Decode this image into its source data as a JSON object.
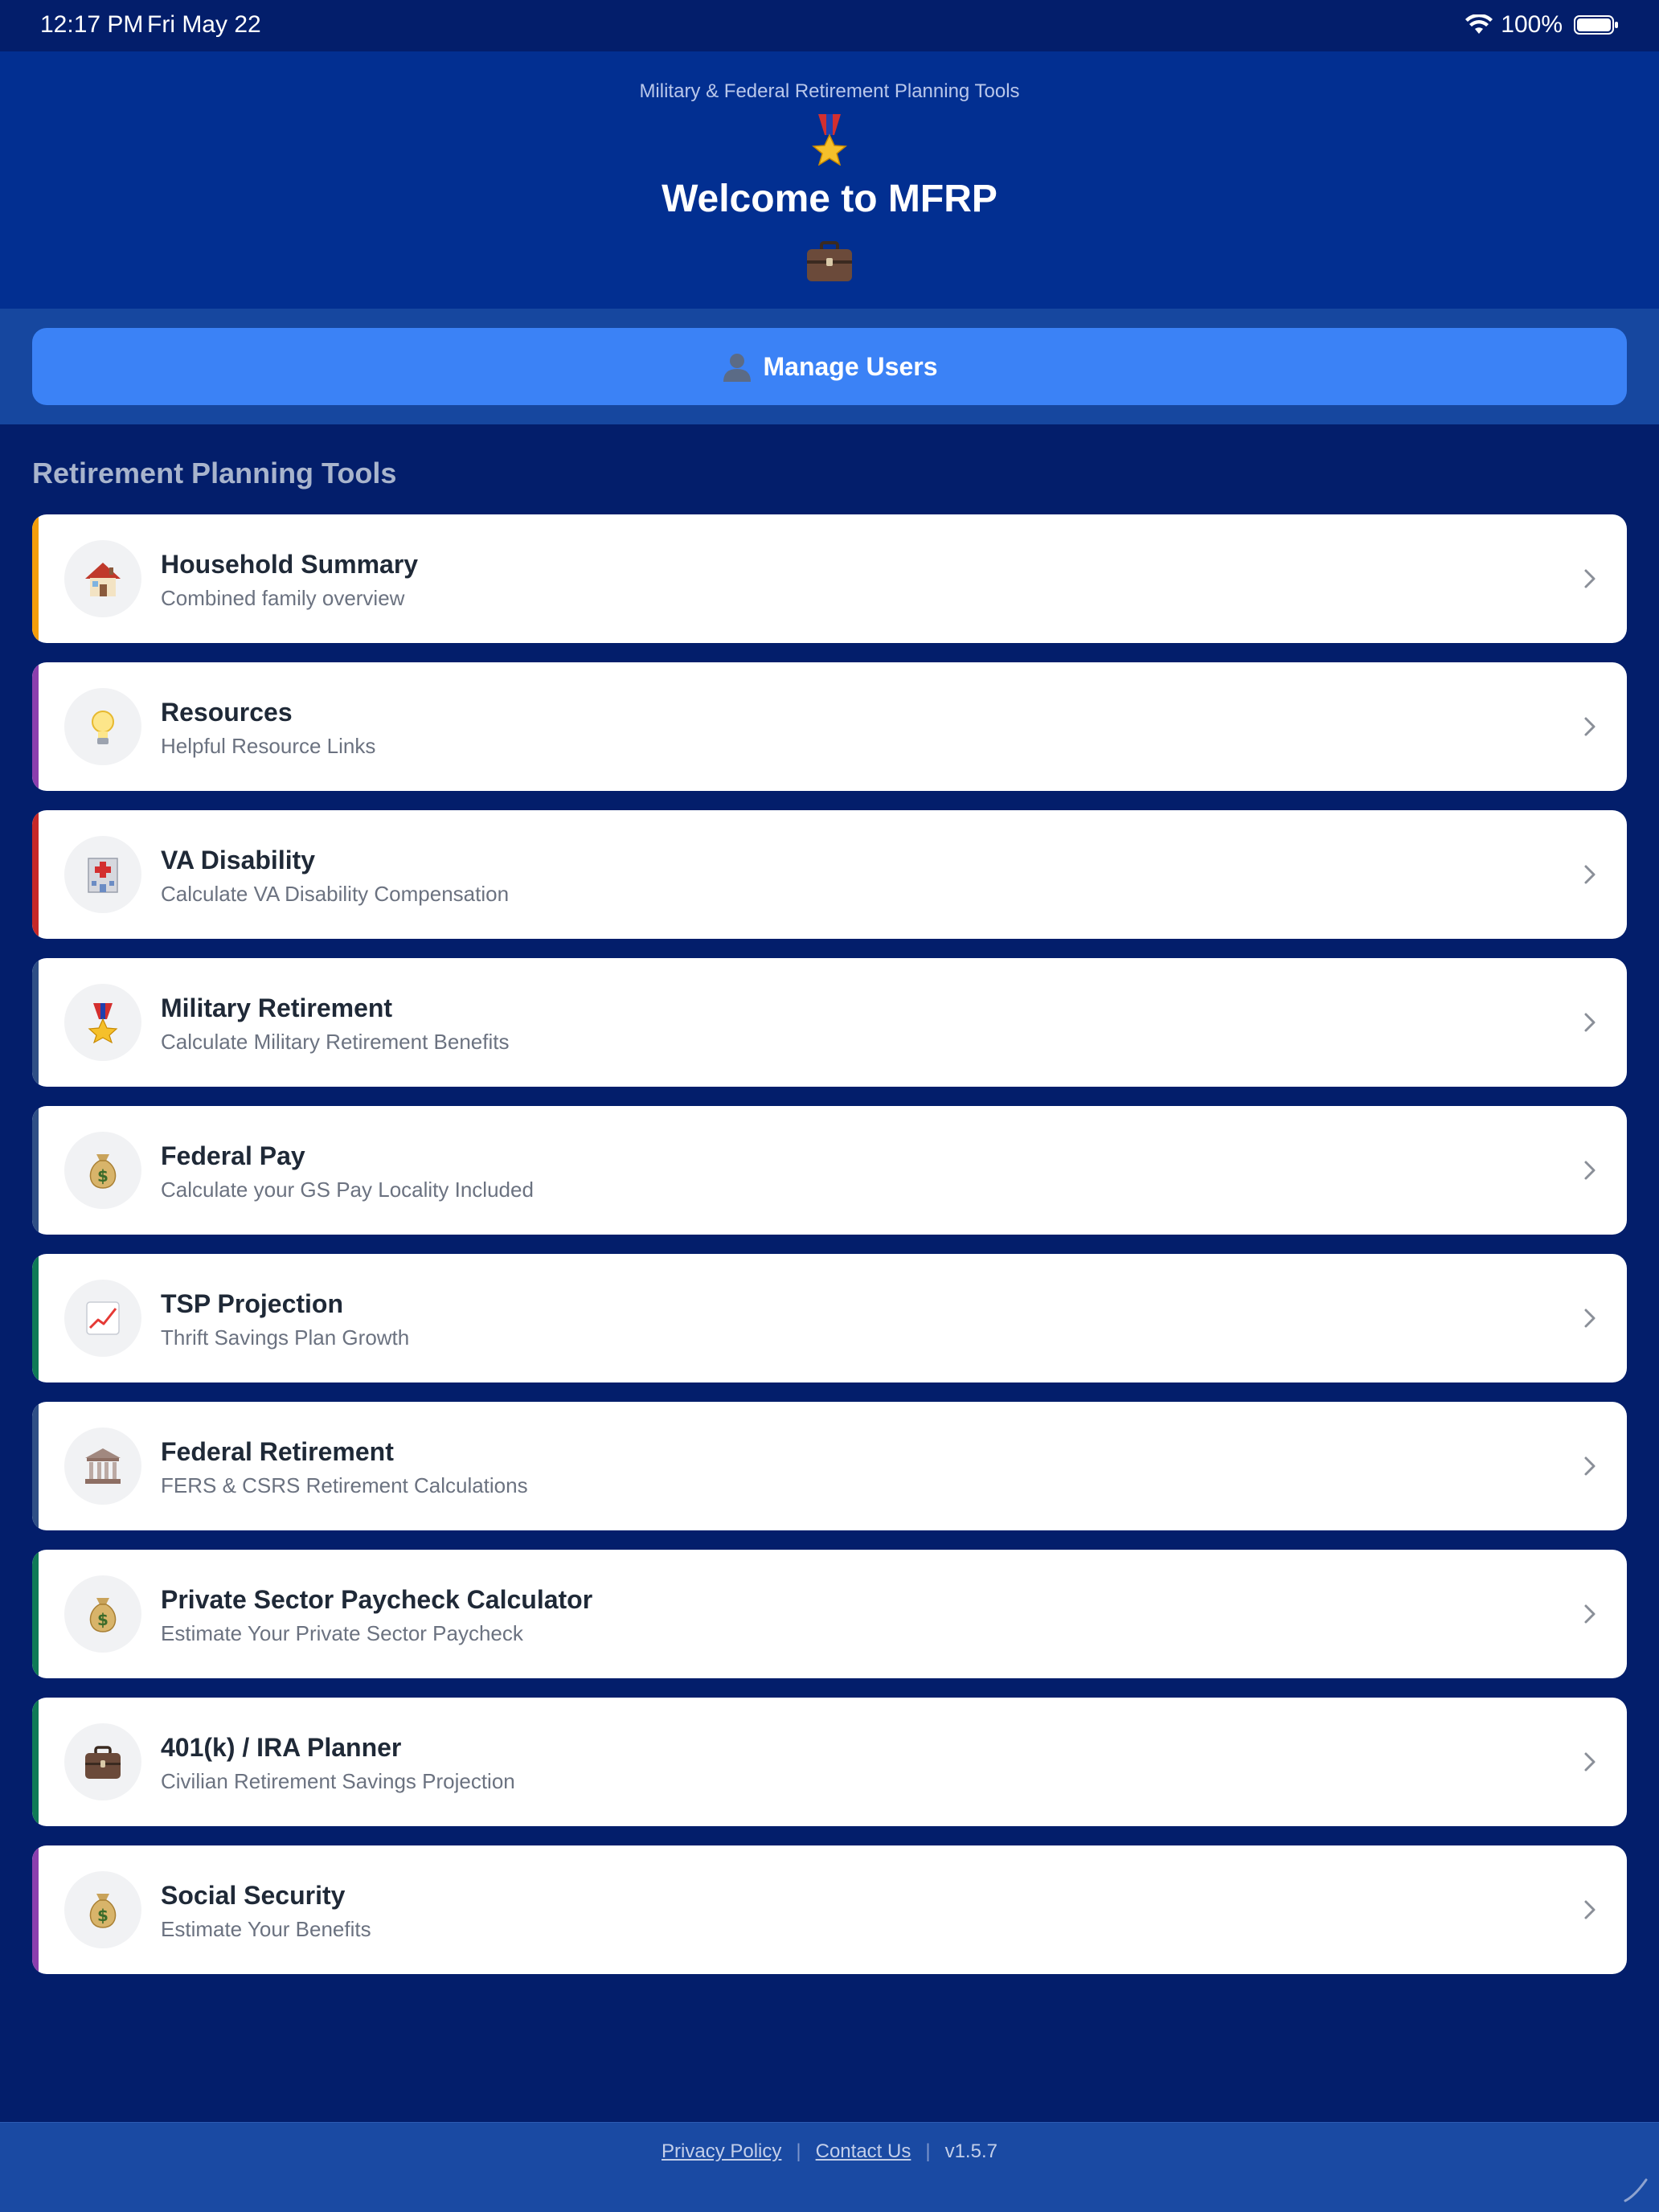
{
  "status": {
    "time": "12:17 PM",
    "date": "Fri May 22",
    "battery": "100%"
  },
  "hero": {
    "subtitle": "Military & Federal Retirement Planning Tools",
    "title": "Welcome to MFRP"
  },
  "manage_users": {
    "label": "Manage Users"
  },
  "section": {
    "title": "Retirement Planning Tools"
  },
  "tools": [
    {
      "title": "Household Summary",
      "subtitle": "Combined family overview",
      "icon": "house-icon",
      "accent": "#f59e0b"
    },
    {
      "title": "Resources",
      "subtitle": "Helpful Resource Links",
      "icon": "lightbulb-icon",
      "accent": "#8b3fae"
    },
    {
      "title": "VA Disability",
      "subtitle": "Calculate VA Disability Compensation",
      "icon": "hospital-icon",
      "accent": "#c62828"
    },
    {
      "title": "Military Retirement",
      "subtitle": "Calculate Military Retirement Benefits",
      "icon": "medal-icon",
      "accent": "#2f4f86"
    },
    {
      "title": "Federal Pay",
      "subtitle": "Calculate your GS Pay Locality Included",
      "icon": "money-bag-icon",
      "accent": "#2f4f86"
    },
    {
      "title": "TSP Projection",
      "subtitle": "Thrift Savings Plan Growth",
      "icon": "chart-increasing-icon",
      "accent": "#0f7a57"
    },
    {
      "title": "Federal Retirement",
      "subtitle": "FERS & CSRS Retirement Calculations",
      "icon": "classical-building-icon",
      "accent": "#2f4f86"
    },
    {
      "title": "Private Sector Paycheck Calculator",
      "subtitle": "Estimate Your Private Sector Paycheck",
      "icon": "money-bag-icon",
      "accent": "#0f7a57"
    },
    {
      "title": "401(k) / IRA Planner",
      "subtitle": "Civilian Retirement Savings Projection",
      "icon": "briefcase-icon",
      "accent": "#0f7a57"
    },
    {
      "title": "Social Security",
      "subtitle": "Estimate Your Benefits",
      "icon": "money-bag-icon",
      "accent": "#8b3fae"
    }
  ],
  "footer": {
    "privacy": "Privacy Policy",
    "contact": "Contact Us",
    "version": "v1.5.7",
    "separator": "|"
  }
}
